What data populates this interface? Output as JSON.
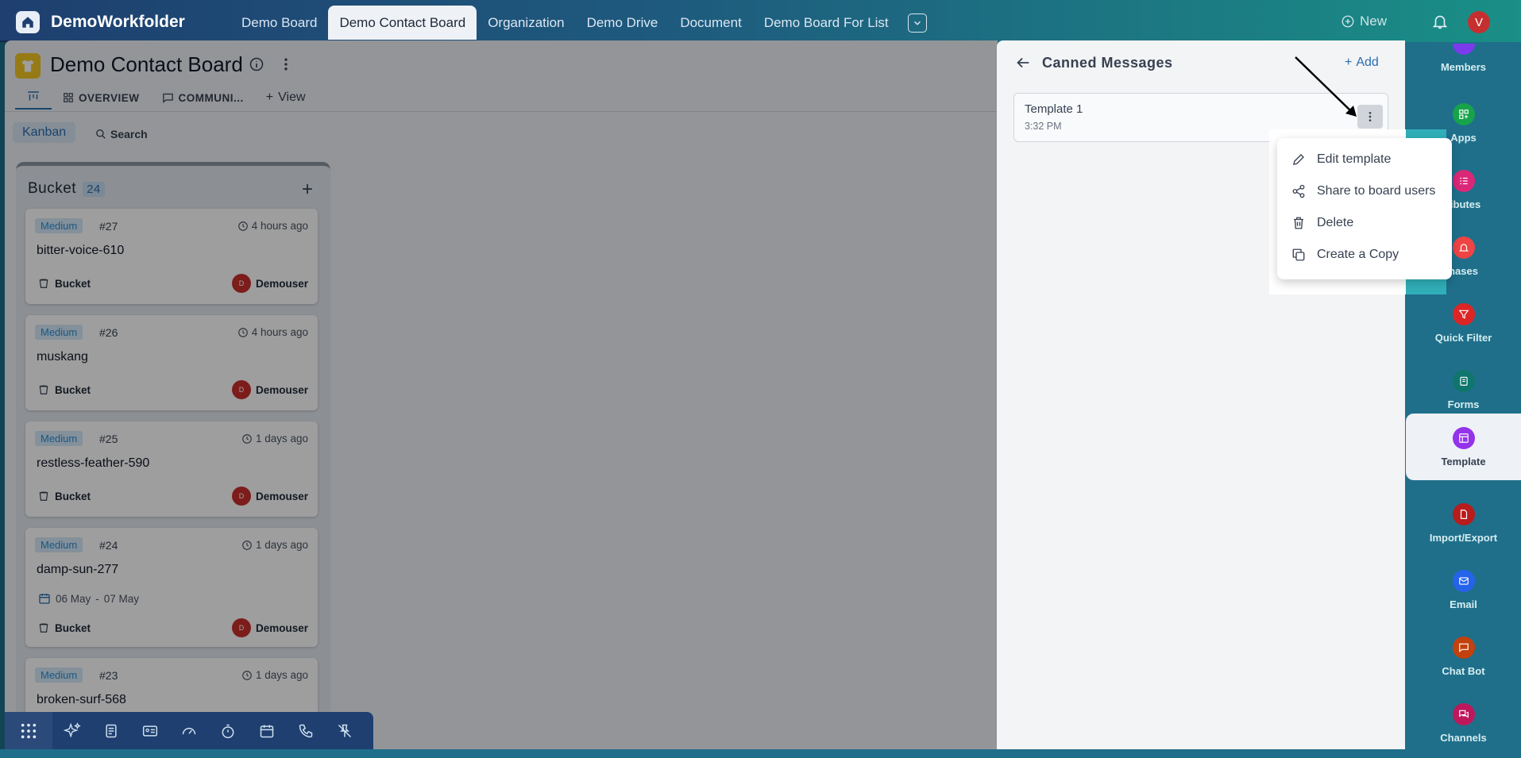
{
  "topbar": {
    "brand": "DemoWorkfolder",
    "tabs": [
      {
        "label": "Demo Board",
        "active": false
      },
      {
        "label": "Demo Contact Board",
        "active": true
      },
      {
        "label": "Organization",
        "active": false
      },
      {
        "label": "Demo Drive",
        "active": false
      },
      {
        "label": "Document",
        "active": false
      },
      {
        "label": "Demo Board For List",
        "active": false
      }
    ],
    "new_label": "New",
    "avatar_initial": "V"
  },
  "board": {
    "title": "Demo Contact Board",
    "view_tabs": {
      "overview": "OVERVIEW",
      "communication": "COMMUNI...",
      "add_view": "View"
    },
    "kanban_label": "Kanban",
    "search_label": "Search"
  },
  "column": {
    "name": "Bucket",
    "count": "24",
    "cards": [
      {
        "priority": "Medium",
        "number": "#27",
        "time": "4 hours ago",
        "title": "bitter-voice-610",
        "bucket": "Bucket",
        "user_initial": "D",
        "user": "Demouser"
      },
      {
        "priority": "Medium",
        "number": "#26",
        "time": "4 hours ago",
        "title": "muskang",
        "bucket": "Bucket",
        "user_initial": "D",
        "user": "Demouser"
      },
      {
        "priority": "Medium",
        "number": "#25",
        "time": "1 days ago",
        "title": "restless-feather-590",
        "bucket": "Bucket",
        "user_initial": "D",
        "user": "Demouser"
      },
      {
        "priority": "Medium",
        "number": "#24",
        "time": "1 days ago",
        "title": "damp-sun-277",
        "date_from": "06 May",
        "date_sep": "-",
        "date_to": "07 May",
        "bucket": "Bucket",
        "user_initial": "D",
        "user": "Demouser"
      },
      {
        "priority": "Medium",
        "number": "#23",
        "time": "1 days ago",
        "title": "broken-surf-568"
      }
    ]
  },
  "panel": {
    "title": "Canned Messages",
    "add_label": "Add",
    "template": {
      "name": "Template 1",
      "time": "3:32 PM"
    }
  },
  "context_menu": {
    "items": [
      {
        "label": "Edit template",
        "icon": "pencil-icon"
      },
      {
        "label": "Share to board users",
        "icon": "share-icon"
      },
      {
        "label": "Delete",
        "icon": "trash-icon"
      },
      {
        "label": "Create a Copy",
        "icon": "copy-icon"
      }
    ]
  },
  "rail": {
    "items": [
      "Members",
      "Apps",
      "ributes",
      "hases",
      "Quick Filter",
      "Forms",
      "Template",
      "Import/Export",
      "Email",
      "Chat Bot",
      "Channels"
    ]
  },
  "colors": {
    "topbar_start": "#1e3f6f",
    "topbar_end": "#1a8f86",
    "accent": "#2b6cb0",
    "priority_bg": "#d6e9f8",
    "avatar_red": "#c9302c"
  }
}
